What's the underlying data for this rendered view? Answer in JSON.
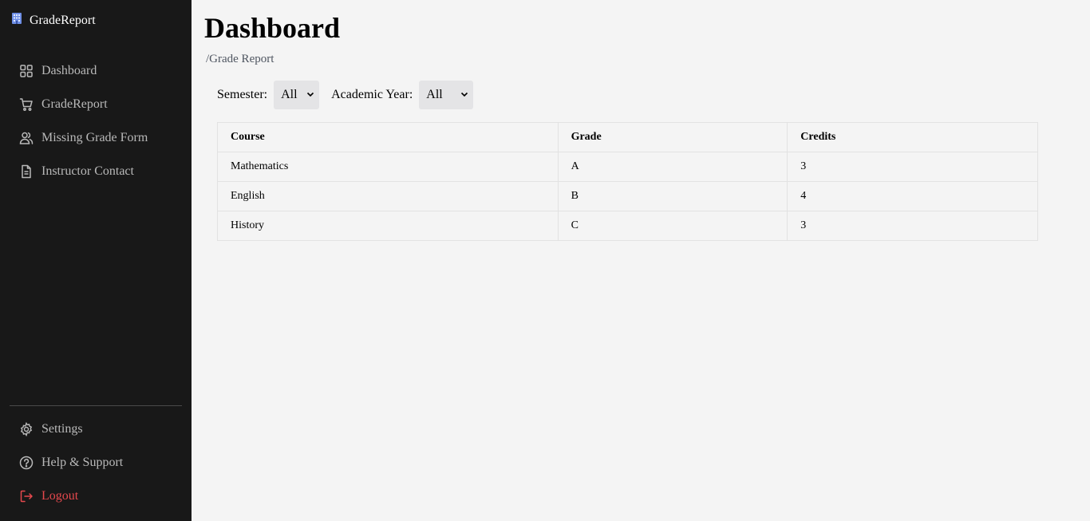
{
  "brand": {
    "name": "GradeReport",
    "icon": "building-icon"
  },
  "sidebar": {
    "items": [
      {
        "label": "Dashboard",
        "icon": "grid-icon"
      },
      {
        "label": "GradeReport",
        "icon": "cart-icon"
      },
      {
        "label": "Missing Grade Form",
        "icon": "users-icon"
      },
      {
        "label": "Instructor Contact",
        "icon": "document-icon"
      }
    ],
    "bottom_items": [
      {
        "label": "Settings",
        "icon": "gear-icon"
      },
      {
        "label": "Help & Support",
        "icon": "help-circle-icon"
      },
      {
        "label": "Logout",
        "icon": "logout-icon"
      }
    ]
  },
  "header": {
    "title": "Dashboard",
    "breadcrumb": "/Grade Report"
  },
  "filters": {
    "semester_label": "Semester:",
    "semester_value": "All",
    "year_label": "Academic Year:",
    "year_value": "All"
  },
  "table": {
    "columns": [
      "Course",
      "Grade",
      "Credits"
    ],
    "rows": [
      [
        "Mathematics",
        "A",
        "3"
      ],
      [
        "English",
        "B",
        "4"
      ],
      [
        "History",
        "C",
        "3"
      ]
    ]
  },
  "colors": {
    "sidebar_bg": "#181818",
    "page_bg": "#f4f4f4",
    "logout": "#e5484d",
    "brand_icon": "#7aa7ff"
  }
}
